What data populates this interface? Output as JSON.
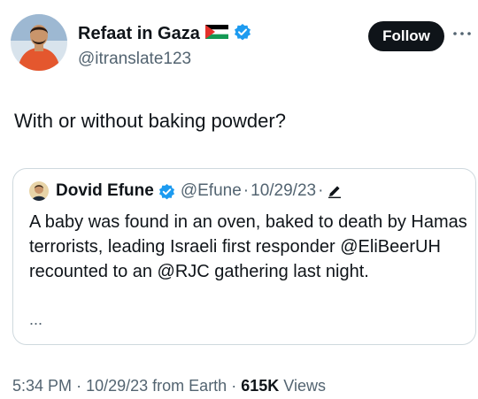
{
  "author": {
    "name": "Refaat in Gaza",
    "handle": "@itranslate123",
    "follow_label": "Follow"
  },
  "tweet": {
    "text": "With or without baking powder?"
  },
  "quoted": {
    "name": "Dovid Efune",
    "handle": "@Efune",
    "separator": "·",
    "date": "10/29/23",
    "text": "A baby was found in an oven, baked to death by Hamas terrorists, leading Israeli first responder @EliBeerUH recounted to an @RJC gathering last night.",
    "ellipsis": "..."
  },
  "footer": {
    "time": "5:34 PM",
    "separator": "·",
    "date": "10/29/23",
    "source": "from Earth",
    "views_count": "615K",
    "views_label": "Views"
  },
  "colors": {
    "verified": "#1d9bf0",
    "follow_bg": "#0f1419",
    "secondary_text": "#536471"
  },
  "icons": {
    "flag": "palestine-flag-icon",
    "verified": "verified-badge-icon",
    "more": "more-icon",
    "edit": "edited-pencil-icon"
  }
}
